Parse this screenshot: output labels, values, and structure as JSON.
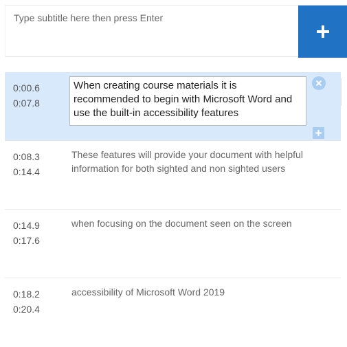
{
  "input": {
    "placeholder": "Type subtitle here then press Enter"
  },
  "add_button": {
    "icon": "plus-icon"
  },
  "colors": {
    "accent": "#1f72c4",
    "active_row": "#d7e9fb",
    "icon_light": "#a9cdf0"
  },
  "captions": [
    {
      "start": "0:00.6",
      "end": "0:07.8",
      "text": "When creating course materials it is recommended to begin with Microsoft Word and use the built-in accessibility features",
      "active": true
    },
    {
      "start": "0:08.3",
      "end": "0:14.4",
      "text": "These features will provide your document with helpful information for both sighted and non sighted users"
    },
    {
      "start": "0:14.9",
      "end": "0:17.6",
      "text": "when focusing on the document seen on the screen"
    },
    {
      "start": "0:18.2",
      "end": "0:20.4",
      "text": "accessibility of Microsoft Word 2019"
    }
  ]
}
